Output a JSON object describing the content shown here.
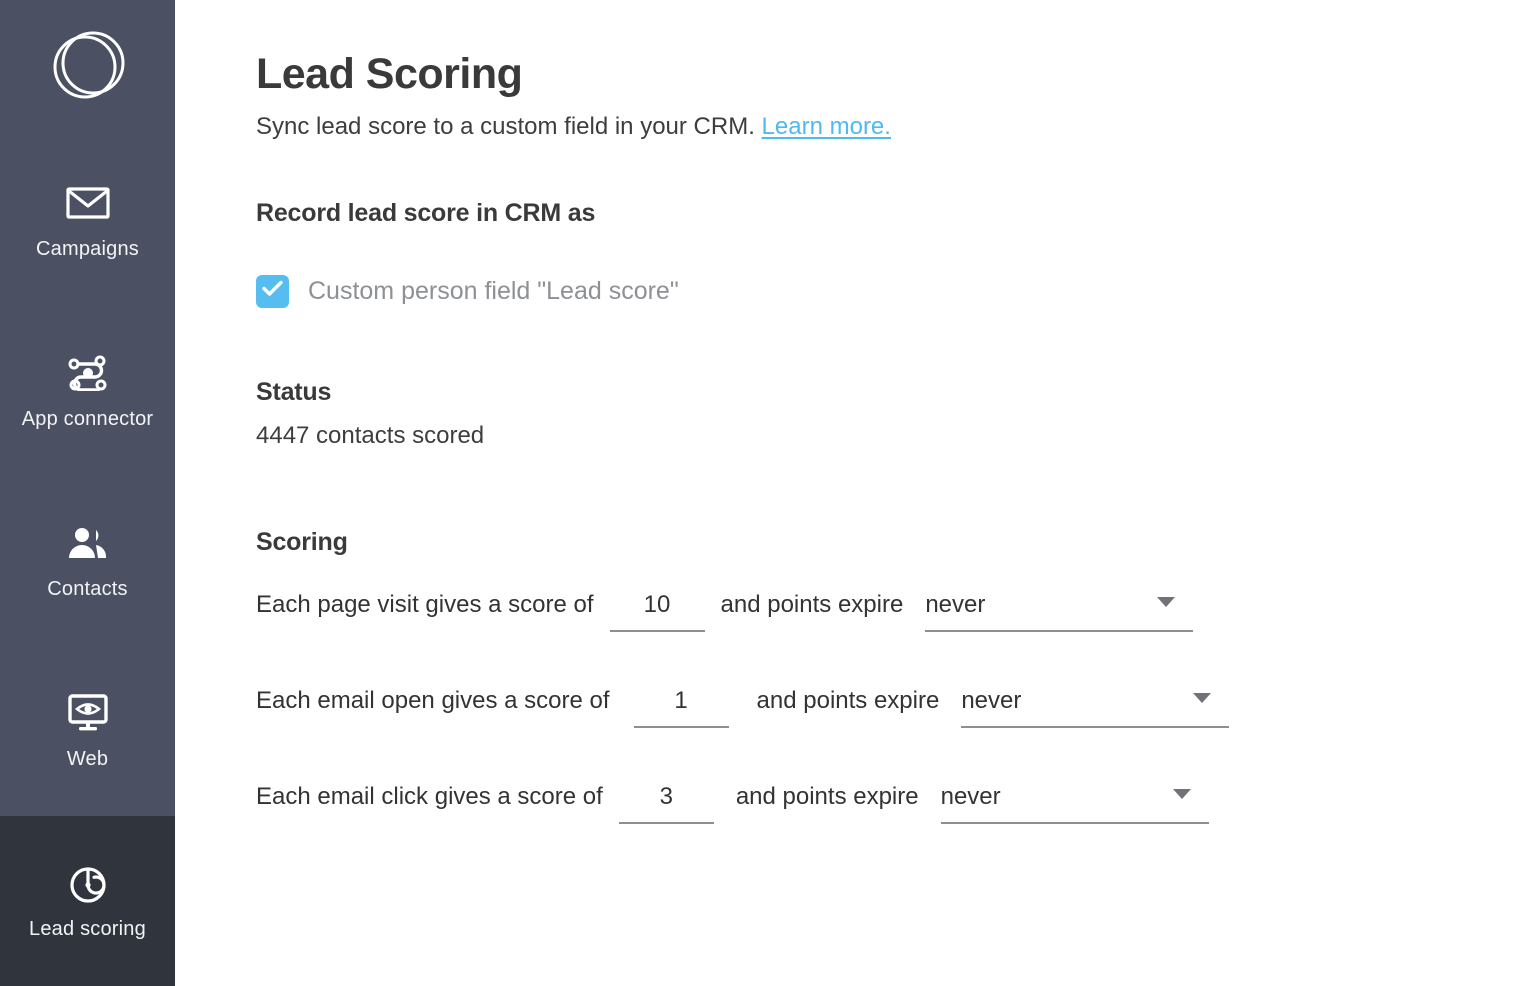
{
  "sidebar": {
    "logo_icon": "overlapping-circles-logo",
    "items": [
      {
        "label": "Campaigns",
        "icon": "envelope-icon",
        "active": false
      },
      {
        "label": "App connector",
        "icon": "connector-nodes-icon",
        "active": false
      },
      {
        "label": "Contacts",
        "icon": "people-icon",
        "active": false
      },
      {
        "label": "Web",
        "icon": "monitor-eye-icon",
        "active": false
      },
      {
        "label": "Lead scoring",
        "icon": "radar-target-icon",
        "active": true
      }
    ]
  },
  "page": {
    "title": "Lead Scoring",
    "subtitle_text": "Sync lead score to a custom field in your CRM.",
    "subtitle_link": "Learn more."
  },
  "record_section": {
    "heading": "Record lead score in CRM as",
    "checkbox_label": "Custom person field \"Lead score\"",
    "checkbox_checked": "true"
  },
  "status_section": {
    "heading": "Status",
    "value": "4447 contacts scored"
  },
  "scoring_section": {
    "heading": "Scoring",
    "rows": [
      {
        "prefix": "Each page visit gives a score of",
        "score": "10",
        "middle": "and points expire",
        "expiry": "never"
      },
      {
        "prefix": "Each email open gives a score of",
        "score": "1",
        "middle": "and points expire",
        "expiry": "never"
      },
      {
        "prefix": "Each email click gives a score of",
        "score": "3",
        "middle": "and points expire",
        "expiry": "never"
      }
    ],
    "expiry_options": [
      "never"
    ]
  },
  "colors": {
    "sidebar_bg": "#4b5162",
    "sidebar_active_bg": "#2f343d",
    "accent_blue": "#4fb9f0",
    "checkbox_blue": "#55bdef",
    "heading_text": "#3a3a3a",
    "body_text": "#333333",
    "muted_text": "#8d9094",
    "rule_gray": "#8f8f8f"
  }
}
